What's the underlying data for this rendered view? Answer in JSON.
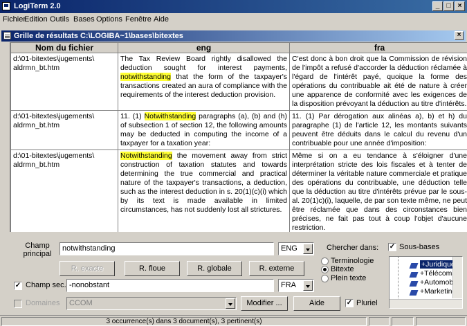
{
  "app": {
    "title": "LogiTerm 2.0"
  },
  "menu": [
    "Fichier",
    "Edition",
    "Outils",
    "Bases",
    "Options",
    "Fenêtre",
    "Aide"
  ],
  "results_window": {
    "title": "Grille de résultats C:\\LOGIBA~1\\bases\\bitextes"
  },
  "columns": {
    "file": "Nom du fichier",
    "en": "eng",
    "fr": "fra"
  },
  "rows": [
    {
      "file": "d:\\01-bitextes\\jugements\\ aldrmn_bt.htm",
      "en_before": "The Tax Review Board rightly disallowed the deduction sought for interest payments, ",
      "en_hit": "notwithstanding",
      "en_after": " that the form of the taxpayer's transactions created an aura of compliance with the requirements of the interest deduction provision.",
      "fr": "C'est donc à bon droit que la Commission de révision de l'impôt a refusé d'accorder la déduction réclamée à l'égard de l'intérêt payé, quoique la forme des opérations du contribuable ait été de nature à créer une apparence de conformité avec les exigences de la disposition prévoyant la déduction au titre d'intérêts."
    },
    {
      "file": "d:\\01-bitextes\\jugements\\ aldrmn_bt.htm",
      "en_before": "11. (1) ",
      "en_hit": "Notwithstanding",
      "en_after": " paragraphs (a), (b) and (h) of subsection 1 of section 12, the following amounts may be deducted in computing the income of a taxpayer for a taxation year:",
      "fr": "11. (1) Par dérogation aux alinéas a), b) et h) du paragraphe (1) de l'article 12, les montants suivants peuvent être déduits dans le calcul du revenu d'un contribuable pour une année d'imposition:"
    },
    {
      "file": "d:\\01-bitextes\\jugements\\ aldrmn_bt.htm",
      "en_before": "",
      "en_hit": "Notwithstanding",
      "en_after": " the movement away from strict construction of taxation statutes and towards determining the true commercial and practical nature of the taxpayer's transactions, a deduction, such as the interest deduction in s. 20(1)(c)(i) which by its text is made available in limited circumstances, has not suddenly lost all strictures.",
      "fr": "Même si on a eu tendance à s'éloigner d'une interprétation stricte des lois fiscales et à tenter de déterminer la véritable nature commerciale et pratique des opérations du contribuable, une déduction telle que la déduction au titre d'intérêts prévue par le sous-al. 20(1)c)(i), laquelle, de par son texte même, ne peut être réclamée que dans des circonstances bien précises, ne fait pas tout à coup l'objet d'aucune restriction."
    }
  ],
  "search": {
    "champ_principal_label": "Champ principal",
    "champ_principal_value": "notwithstanding",
    "lang_main": "ENG",
    "chercher_dans_label": "Chercher dans:",
    "sous_bases_label": "Sous-bases",
    "sous_bases_checked": true,
    "btn_exacte": "R. exacte",
    "btn_floue": "R. floue",
    "btn_globale": "R. globale",
    "btn_externe": "R. externe",
    "radio_terminologie": "Terminologie",
    "radio_bitexte": "Bitexte",
    "radio_plein_texte": "Plein texte",
    "radio_selected": "Bitexte",
    "champ_sec_label": "Champ sec.",
    "champ_sec_checked": true,
    "champ_sec_value": "-nonobstant",
    "lang_sec": "FRA",
    "domaines_label": "Domaines",
    "domaines_value": "CCOM",
    "btn_modifier": "Modifier ...",
    "btn_aide": "Aide",
    "pluriel_label": "Pluriel",
    "pluriel_checked": true
  },
  "subbases": [
    "Juridique",
    "Télécoms",
    "Automobil",
    "Marketing"
  ],
  "status": {
    "text": "3 occurrence(s) dans 3 document(s), 3 pertinent(s)"
  }
}
